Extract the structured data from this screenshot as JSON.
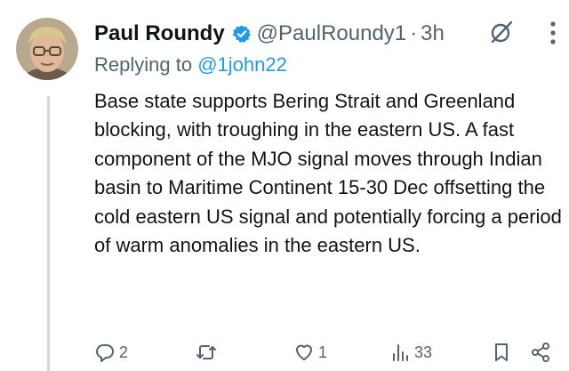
{
  "tweet": {
    "display_name": "Paul Roundy",
    "handle": "@PaulRoundy1",
    "separator": "·",
    "time": "3h",
    "replying_prefix": "Replying to",
    "replying_to": "@1john22",
    "text": "Base state supports Bering Strait and Greenland blocking, with troughing in the eastern US. A fast component of the MJO signal moves through Indian basin to Maritime Continent 15-30 Dec offsetting the cold eastern US signal and potentially forcing a period of warm anomalies in the eastern US."
  },
  "actions": {
    "reply_count": "2",
    "repost_count": "",
    "like_count": "1",
    "views_count": "33"
  },
  "icons": {
    "verified": "verified-badge-icon",
    "grok": "grok-icon",
    "more": "more-icon",
    "reply": "reply-icon",
    "repost": "repost-icon",
    "like": "like-icon",
    "views": "views-icon",
    "bookmark": "bookmark-icon",
    "share": "share-icon"
  },
  "colors": {
    "text_primary": "#0f1419",
    "text_secondary": "#536471",
    "accent": "#1d9bf0",
    "thread_line": "#cfd9de"
  }
}
